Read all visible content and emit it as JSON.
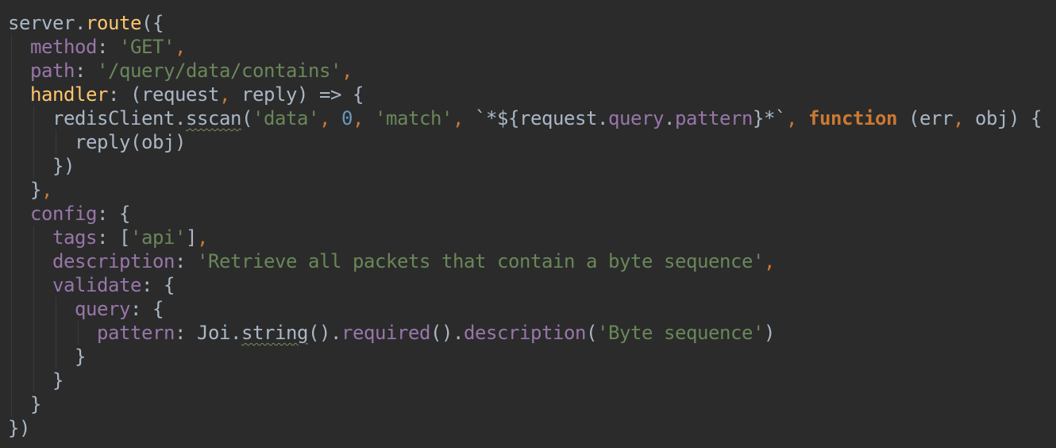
{
  "editor": {
    "theme_colors": {
      "background": "#2b2b2b",
      "identifier": "#a9b7c6",
      "function_name": "#ffc66d",
      "property": "#9876aa",
      "string": "#6a8759",
      "number": "#6897bb",
      "keyword": "#cc7832"
    },
    "lines": [
      {
        "tokens": [
          {
            "t": "server",
            "k": "ident"
          },
          {
            "t": ".",
            "k": "ident"
          },
          {
            "t": "route",
            "k": "func"
          },
          {
            "t": "({",
            "k": "ident"
          }
        ]
      },
      {
        "tokens": [
          {
            "t": "  ",
            "k": "ident"
          },
          {
            "t": "method",
            "k": "prop"
          },
          {
            "t": ": ",
            "k": "ident"
          },
          {
            "t": "'GET'",
            "k": "str"
          },
          {
            "t": ",",
            "k": "punct"
          }
        ]
      },
      {
        "tokens": [
          {
            "t": "  ",
            "k": "ident"
          },
          {
            "t": "path",
            "k": "prop"
          },
          {
            "t": ": ",
            "k": "ident"
          },
          {
            "t": "'/query/data/contains'",
            "k": "str"
          },
          {
            "t": ",",
            "k": "punct"
          }
        ]
      },
      {
        "tokens": [
          {
            "t": "  ",
            "k": "ident"
          },
          {
            "t": "handler",
            "k": "func"
          },
          {
            "t": ": (request",
            "k": "ident"
          },
          {
            "t": ",",
            "k": "punct"
          },
          {
            "t": " reply) => {",
            "k": "ident"
          }
        ]
      },
      {
        "tokens": [
          {
            "t": "    redisClient.",
            "k": "ident"
          },
          {
            "t": "sscan",
            "k": "ident",
            "squiggle": true
          },
          {
            "t": "(",
            "k": "ident"
          },
          {
            "t": "'data'",
            "k": "str"
          },
          {
            "t": ", ",
            "k": "punct"
          },
          {
            "t": "0",
            "k": "num"
          },
          {
            "t": ", ",
            "k": "punct"
          },
          {
            "t": "'match'",
            "k": "str"
          },
          {
            "t": ", ",
            "k": "punct"
          },
          {
            "t": "`",
            "k": "tmpl"
          },
          {
            "t": "*",
            "k": "tmplstar"
          },
          {
            "t": "${request.",
            "k": "ident"
          },
          {
            "t": "query",
            "k": "prop"
          },
          {
            "t": ".",
            "k": "ident"
          },
          {
            "t": "pattern",
            "k": "prop"
          },
          {
            "t": "}",
            "k": "ident"
          },
          {
            "t": "*",
            "k": "tmplstar"
          },
          {
            "t": "`",
            "k": "tmpl"
          },
          {
            "t": ", ",
            "k": "punct"
          },
          {
            "t": "function",
            "k": "kw"
          },
          {
            "t": " (err",
            "k": "ident"
          },
          {
            "t": ",",
            "k": "punct"
          },
          {
            "t": " obj) {",
            "k": "ident"
          }
        ]
      },
      {
        "tokens": [
          {
            "t": "      reply(obj)",
            "k": "ident"
          }
        ]
      },
      {
        "tokens": [
          {
            "t": "    })",
            "k": "ident"
          }
        ]
      },
      {
        "tokens": [
          {
            "t": "  }",
            "k": "ident"
          },
          {
            "t": ",",
            "k": "punct"
          }
        ]
      },
      {
        "tokens": [
          {
            "t": "  ",
            "k": "ident"
          },
          {
            "t": "config",
            "k": "prop"
          },
          {
            "t": ": {",
            "k": "ident"
          }
        ]
      },
      {
        "tokens": [
          {
            "t": "    ",
            "k": "ident"
          },
          {
            "t": "tags",
            "k": "prop"
          },
          {
            "t": ": [",
            "k": "ident"
          },
          {
            "t": "'api'",
            "k": "str"
          },
          {
            "t": "]",
            "k": "ident"
          },
          {
            "t": ",",
            "k": "punct"
          }
        ]
      },
      {
        "tokens": [
          {
            "t": "    ",
            "k": "ident"
          },
          {
            "t": "description",
            "k": "prop"
          },
          {
            "t": ": ",
            "k": "ident"
          },
          {
            "t": "'Retrieve all packets that contain a byte sequence'",
            "k": "str"
          },
          {
            "t": ",",
            "k": "punct"
          }
        ]
      },
      {
        "tokens": [
          {
            "t": "    ",
            "k": "ident"
          },
          {
            "t": "validate",
            "k": "prop"
          },
          {
            "t": ": {",
            "k": "ident"
          }
        ]
      },
      {
        "tokens": [
          {
            "t": "      ",
            "k": "ident"
          },
          {
            "t": "query",
            "k": "prop"
          },
          {
            "t": ": {",
            "k": "ident"
          }
        ]
      },
      {
        "tokens": [
          {
            "t": "        ",
            "k": "ident"
          },
          {
            "t": "pattern",
            "k": "prop"
          },
          {
            "t": ": Joi.",
            "k": "ident"
          },
          {
            "t": "string",
            "k": "ident",
            "squiggle": true
          },
          {
            "t": "().",
            "k": "ident"
          },
          {
            "t": "required",
            "k": "prop"
          },
          {
            "t": "().",
            "k": "ident"
          },
          {
            "t": "description",
            "k": "prop"
          },
          {
            "t": "(",
            "k": "ident"
          },
          {
            "t": "'Byte sequence'",
            "k": "str"
          },
          {
            "t": ")",
            "k": "ident"
          }
        ]
      },
      {
        "tokens": [
          {
            "t": "      }",
            "k": "ident"
          }
        ]
      },
      {
        "tokens": [
          {
            "t": "    }",
            "k": "ident"
          }
        ]
      },
      {
        "tokens": [
          {
            "t": "  }",
            "k": "ident"
          }
        ]
      },
      {
        "tokens": [
          {
            "t": "})",
            "k": "ident"
          }
        ]
      }
    ]
  }
}
